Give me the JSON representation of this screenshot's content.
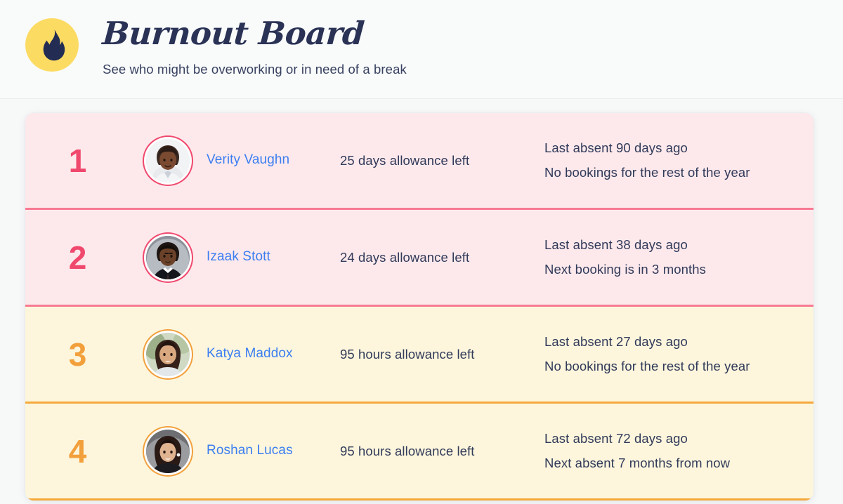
{
  "header": {
    "logo_icon": "flame-icon",
    "logo_bg": "#fcdb63",
    "logo_fg": "#232c52",
    "title": "Burnout Board",
    "subtitle": "See who might be overworking or in need of a break"
  },
  "colors": {
    "page_bg": "#f7f9f9",
    "card_bg": "#ffffff",
    "danger_bg": "#fde9ec",
    "danger_accent": "#f0486d",
    "danger_divider": "#f77a92",
    "warn_bg": "#fdf6dd",
    "warn_accent": "#f2a03c",
    "warn_divider": "#f5a93c",
    "link": "#3c7ef0",
    "text": "#313a59"
  },
  "board": {
    "rows": [
      {
        "rank": "1",
        "name": "Verity Vaughn",
        "allowance": "25 days allowance left",
        "detail_primary": "Last absent 90 days ago",
        "detail_secondary": "No bookings for the rest of the year",
        "tone": "danger",
        "avatar_alt": "Verity Vaughn avatar"
      },
      {
        "rank": "2",
        "name": "Izaak Stott",
        "allowance": "24 days allowance left",
        "detail_primary": "Last absent 38 days ago",
        "detail_secondary": "Next booking is in 3 months",
        "tone": "danger",
        "avatar_alt": "Izaak Stott avatar"
      },
      {
        "rank": "3",
        "name": "Katya Maddox",
        "allowance": "95 hours allowance left",
        "detail_primary": "Last absent 27 days ago",
        "detail_secondary": "No bookings for the rest of the year",
        "tone": "warn",
        "avatar_alt": "Katya Maddox avatar"
      },
      {
        "rank": "4",
        "name": "Roshan Lucas",
        "allowance": "95 hours allowance left",
        "detail_primary": "Last absent 72 days ago",
        "detail_secondary": "Next absent 7 months from now",
        "tone": "warn",
        "avatar_alt": "Roshan Lucas avatar"
      }
    ]
  }
}
